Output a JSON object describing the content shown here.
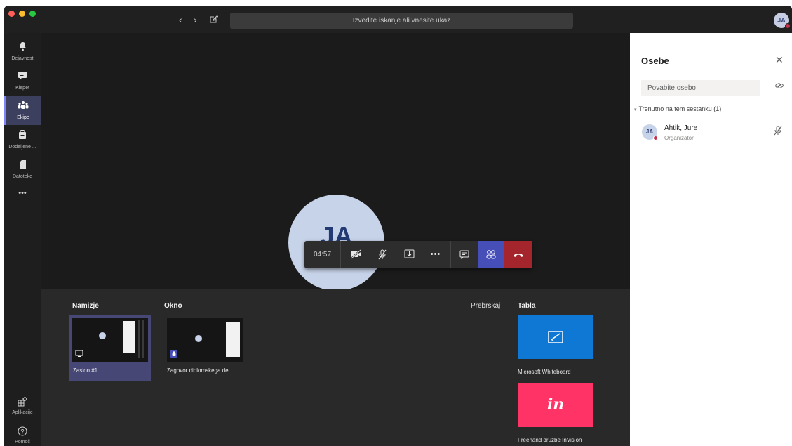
{
  "titlebar": {
    "search_placeholder": "Izvedite iskanje ali vnesite ukaz",
    "nav_back_icon": "chevron-left-icon",
    "nav_forward_icon": "chevron-right-icon",
    "compose_icon": "compose-icon",
    "avatar_initials": "JA",
    "status_color": "#c4314b"
  },
  "rail": {
    "items": [
      {
        "label": "Dejavnost",
        "icon": "bell-icon"
      },
      {
        "label": "Klepet",
        "icon": "chat-icon"
      },
      {
        "label": "Ekipe",
        "icon": "teams-icon"
      },
      {
        "label": "Dodeljene ...",
        "icon": "assignments-icon"
      },
      {
        "label": "Datoteke",
        "icon": "files-icon"
      }
    ],
    "more": "•••",
    "apps_label": "Aplikacije",
    "help_label": "Pomoč",
    "active_index": 2
  },
  "stage": {
    "avatar_initials": "JA",
    "timer": "04:57"
  },
  "tray": {
    "desktop_title": "Namizje",
    "window_title": "Okno",
    "browse_label": "Prebrskaj",
    "whiteboard_title": "Tabla",
    "screen_caption": "Zaslon #1",
    "window_caption": "Zagovor diplomskega del...",
    "whiteboard_caption": "Microsoft Whiteboard",
    "invision_caption": "Freehand družbe InVision",
    "invision_logo": "in",
    "whiteboard_color": "#0f78d4",
    "invision_color": "#ff3366"
  },
  "panel": {
    "title": "Osebe",
    "invite_placeholder": "Povabite osebo",
    "group_label": "Trenutno na tem sestanku (1)",
    "participant": {
      "initials": "JA",
      "name": "Ahtik, Jure",
      "role": "Organizator"
    }
  },
  "colors": {
    "accent": "#464eb8",
    "hangup": "#a4262c",
    "rail_active": "#7f85f5"
  }
}
